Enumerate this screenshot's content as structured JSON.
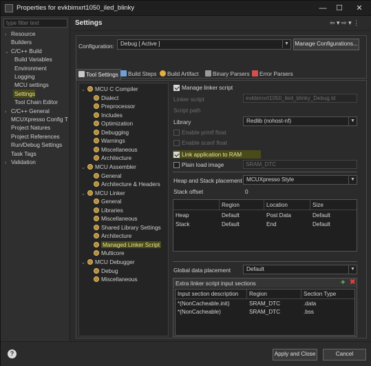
{
  "window": {
    "title": "Properties for evkbimxrt1050_iled_blinky",
    "controls": {
      "minimize": "—",
      "maximize": "☐",
      "close": "✕"
    }
  },
  "filter": {
    "placeholder": "type filter text"
  },
  "nav_tree": [
    {
      "label": "Resource",
      "twisty": "›",
      "level": 0
    },
    {
      "label": "Builders",
      "twisty": "",
      "level": 0
    },
    {
      "label": "C/C++ Build",
      "twisty": "⌄",
      "level": 0
    },
    {
      "label": "Build Variables",
      "twisty": "",
      "level": 1
    },
    {
      "label": "Environment",
      "twisty": "",
      "level": 1
    },
    {
      "label": "Logging",
      "twisty": "",
      "level": 1
    },
    {
      "label": "MCU settings",
      "twisty": "",
      "level": 1
    },
    {
      "label": "Settings",
      "twisty": "",
      "level": 1,
      "selected": true
    },
    {
      "label": "Tool Chain Editor",
      "twisty": "",
      "level": 1
    },
    {
      "label": "C/C++ General",
      "twisty": "›",
      "level": 0
    },
    {
      "label": "MCUXpresso Config T",
      "twisty": "",
      "level": 0
    },
    {
      "label": "Project Natures",
      "twisty": "",
      "level": 0
    },
    {
      "label": "Project References",
      "twisty": "",
      "level": 0
    },
    {
      "label": "Run/Debug Settings",
      "twisty": "",
      "level": 0
    },
    {
      "label": "Task Tags",
      "twisty": "",
      "level": 0
    },
    {
      "label": "Validation",
      "twisty": "›",
      "level": 0
    }
  ],
  "header": {
    "title": "Settings",
    "nav": "⇦ ▾ ⇨ ▾ ⋮"
  },
  "configuration": {
    "label": "Configuration:",
    "value": "Debug  [ Active ]",
    "manage_button": "Manage Configurations..."
  },
  "tabs": [
    {
      "label": "Tool Settings",
      "active": true,
      "color": "#c9c9c9"
    },
    {
      "label": "Build Steps",
      "active": false,
      "color": "#6fa0d8"
    },
    {
      "label": "Build Artifact",
      "active": false,
      "color": "#e0b040"
    },
    {
      "label": "Binary Parsers",
      "active": false,
      "color": "#9a9a9a"
    },
    {
      "label": "Error Parsers",
      "active": false,
      "color": "#d05050"
    }
  ],
  "tool_tree": [
    {
      "label": "MCU C Compiler",
      "level": 0,
      "twisty": "⌄"
    },
    {
      "label": "Dialect",
      "level": 1
    },
    {
      "label": "Preprocessor",
      "level": 1
    },
    {
      "label": "Includes",
      "level": 1
    },
    {
      "label": "Optimization",
      "level": 1
    },
    {
      "label": "Debugging",
      "level": 1
    },
    {
      "label": "Warnings",
      "level": 1
    },
    {
      "label": "Miscellaneous",
      "level": 1
    },
    {
      "label": "Architecture",
      "level": 1
    },
    {
      "label": "MCU Assembler",
      "level": 0,
      "twisty": "⌄"
    },
    {
      "label": "General",
      "level": 1
    },
    {
      "label": "Architecture & Headers",
      "level": 1
    },
    {
      "label": "MCU Linker",
      "level": 0,
      "twisty": "⌄"
    },
    {
      "label": "General",
      "level": 1
    },
    {
      "label": "Libraries",
      "level": 1
    },
    {
      "label": "Miscellaneous",
      "level": 1
    },
    {
      "label": "Shared Library Settings",
      "level": 1
    },
    {
      "label": "Architecture",
      "level": 1
    },
    {
      "label": "Managed Linker Script",
      "level": 1,
      "selected": true
    },
    {
      "label": "Multicore",
      "level": 1
    },
    {
      "label": "MCU Debugger",
      "level": 0,
      "twisty": "⌄"
    },
    {
      "label": "Debug",
      "level": 1
    },
    {
      "label": "Miscellaneous",
      "level": 1
    }
  ],
  "linker": {
    "manage_script": {
      "label": "Manage linker script",
      "checked": true
    },
    "linker_script_label": "Linker script",
    "linker_script_value": "evkbimxrt1050_iled_blinky_Debug.ld",
    "script_path_label": "Script path",
    "library_label": "Library",
    "library_value": "Redlib (nohost-nf)",
    "enable_printf": "Enable printf float",
    "enable_scanf": "Enable scanf float",
    "link_to_ram": {
      "label": "Link application to RAM",
      "checked": true
    },
    "plain_load": {
      "label": "Plain load image",
      "checked": false,
      "value": "SRAM_DTC"
    },
    "heap_stack_label": "Heap and Stack placement",
    "heap_stack_value": "MCUXpresso Style",
    "stack_offset_label": "Stack offset",
    "stack_offset_value": "0",
    "hs_table": {
      "headers": [
        "",
        "Region",
        "Location",
        "Size"
      ],
      "rows": [
        [
          "Heap",
          "Default",
          "Post Data",
          "Default"
        ],
        [
          "Stack",
          "Default",
          "End",
          "Default"
        ]
      ]
    },
    "global_label": "Global data placement",
    "global_value": "Default",
    "extra_label": "Extra linker script input sections",
    "extra_table": {
      "headers": [
        "Input section description",
        "Region",
        "Section Type"
      ],
      "rows": [
        [
          "*(NonCacheable.init)",
          "SRAM_DTC",
          ".data"
        ],
        [
          "*(NonCacheable)",
          "SRAM_DTC",
          ".bss"
        ]
      ]
    }
  },
  "footer": {
    "apply_close": "Apply and Close",
    "cancel": "Cancel",
    "help": "?"
  }
}
